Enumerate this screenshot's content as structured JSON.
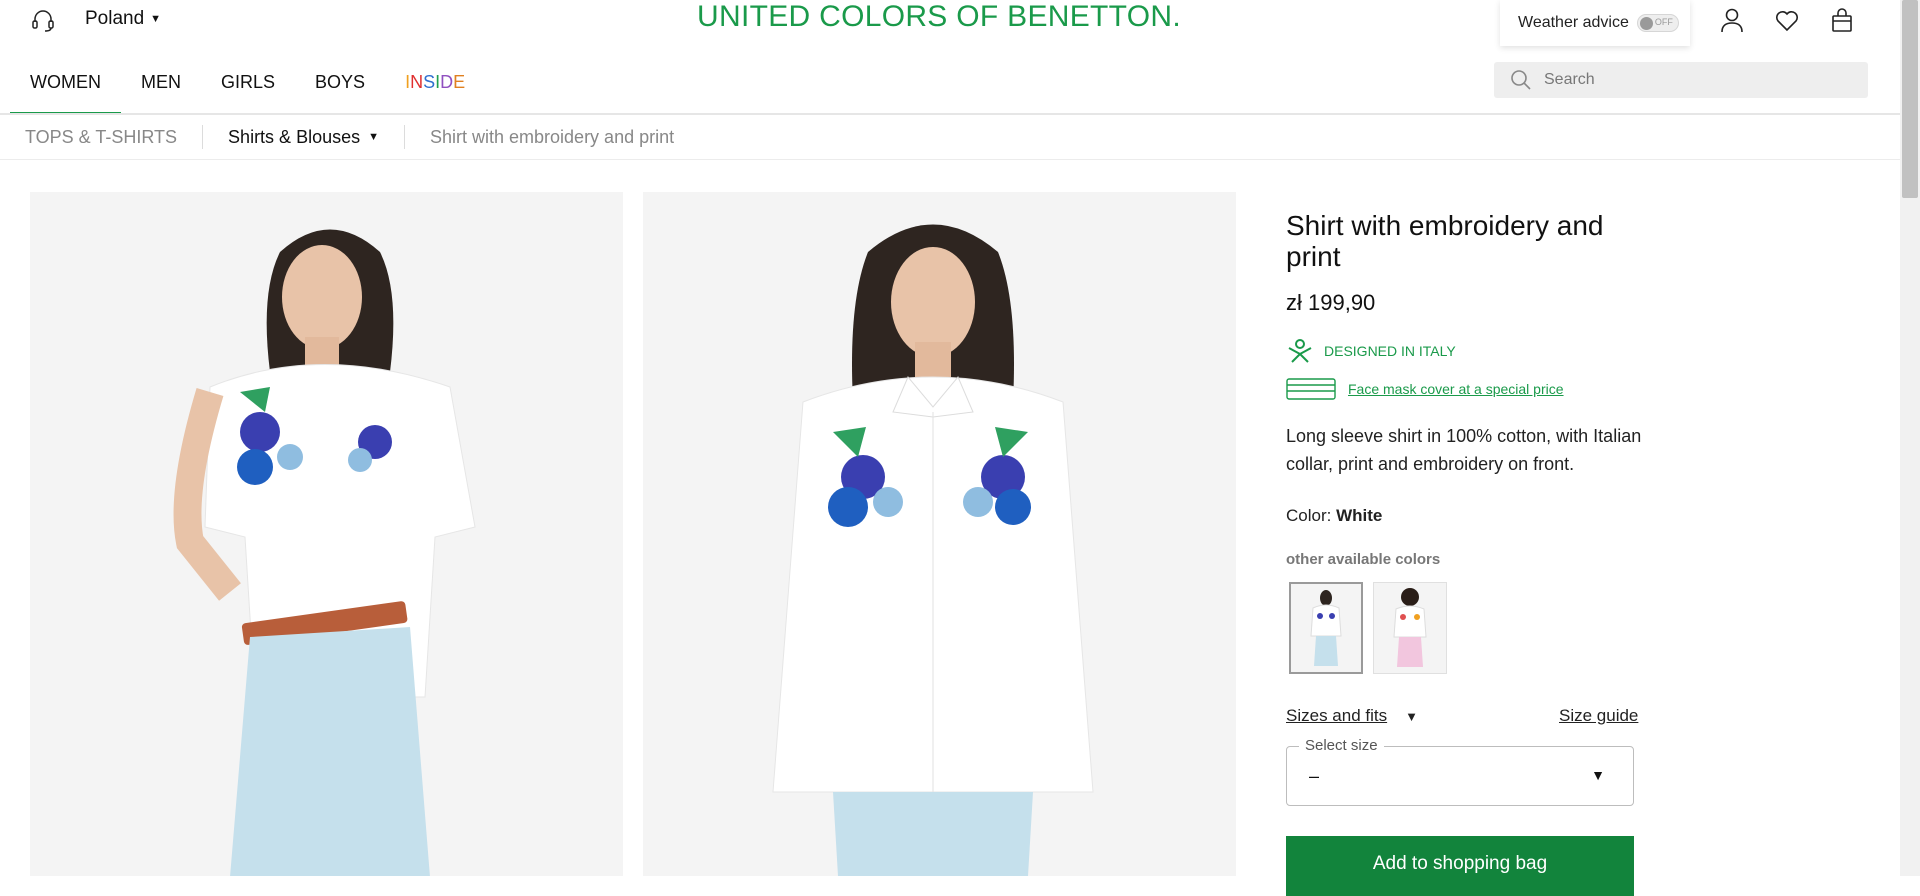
{
  "header": {
    "country": "Poland",
    "brand": "UNITED COLORS OF BENETTON.",
    "weather_label": "Weather advice",
    "weather_toggle": "OFF",
    "search_placeholder": "Search"
  },
  "nav": {
    "items": [
      "WOMEN",
      "MEN",
      "GIRLS",
      "BOYS"
    ],
    "inside_letters": [
      "I",
      "N",
      "S",
      "I",
      "D",
      "E"
    ],
    "inside_colors": [
      "#f0a020",
      "#e03030",
      "#3070d0",
      "#20a050",
      "#9050c0",
      "#e08020"
    ]
  },
  "breadcrumb": {
    "category": "TOPS & T-SHIRTS",
    "subcategory": "Shirts & Blouses",
    "current": "Shirt with embroidery and print"
  },
  "product": {
    "title": "Shirt with embroidery and print",
    "price": "zł 199,90",
    "designed": "DESIGNED IN ITALY",
    "promo": "Face mask cover at a special price",
    "description": "Long sleeve shirt in 100% cotton, with Italian collar, print and embroidery on front.",
    "color_label": "Color:",
    "color_value": "White",
    "other_colors": "other available colors",
    "sizes_fits": "Sizes and fits",
    "size_guide": "Size guide",
    "select_size_label": "Select size",
    "select_size_value": "–",
    "add_to_bag": "Add to shopping bag"
  },
  "colors": {
    "brand_green": "#1a9a4a",
    "button_green": "#12843c"
  }
}
